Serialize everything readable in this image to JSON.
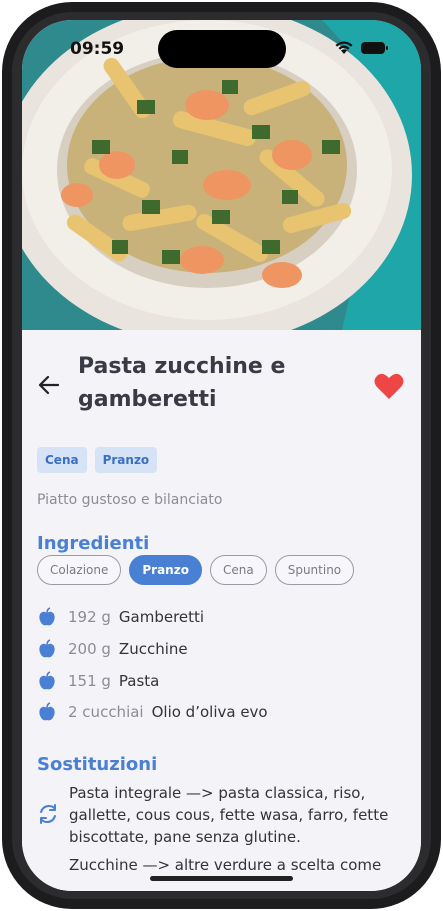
{
  "status_bar": {
    "time": "09:59"
  },
  "recipe": {
    "title": "Pasta zucchine e gamberetti",
    "tags": [
      "Cena",
      "Pranzo"
    ],
    "description": "Piatto gustoso e bilanciato",
    "favorite": true
  },
  "ingredients": {
    "heading": "Ingredienti",
    "meal_filters": [
      {
        "label": "Colazione",
        "active": false
      },
      {
        "label": "Pranzo",
        "active": true
      },
      {
        "label": "Cena",
        "active": false
      },
      {
        "label": "Spuntino",
        "active": false
      }
    ],
    "items": [
      {
        "qty": "192 g",
        "name": "Gamberetti"
      },
      {
        "qty": "200 g",
        "name": "Zucchine"
      },
      {
        "qty": "151 g",
        "name": "Pasta"
      },
      {
        "qty": "2 cucchiai",
        "name": "Olio d’oliva evo"
      }
    ]
  },
  "substitutions": {
    "heading": "Sostituzioni",
    "items": [
      "Pasta integrale —> pasta classica, riso, gallette, cous cous, fette wasa, farro, fette biscottate, pane senza glutine.",
      "Zucchine —> altre verdure a scelta come"
    ]
  },
  "colors": {
    "accent": "#4a80d4",
    "tag_bg": "#d6e2f5",
    "heart": "#ee4545",
    "background": "#f3f3f8"
  }
}
